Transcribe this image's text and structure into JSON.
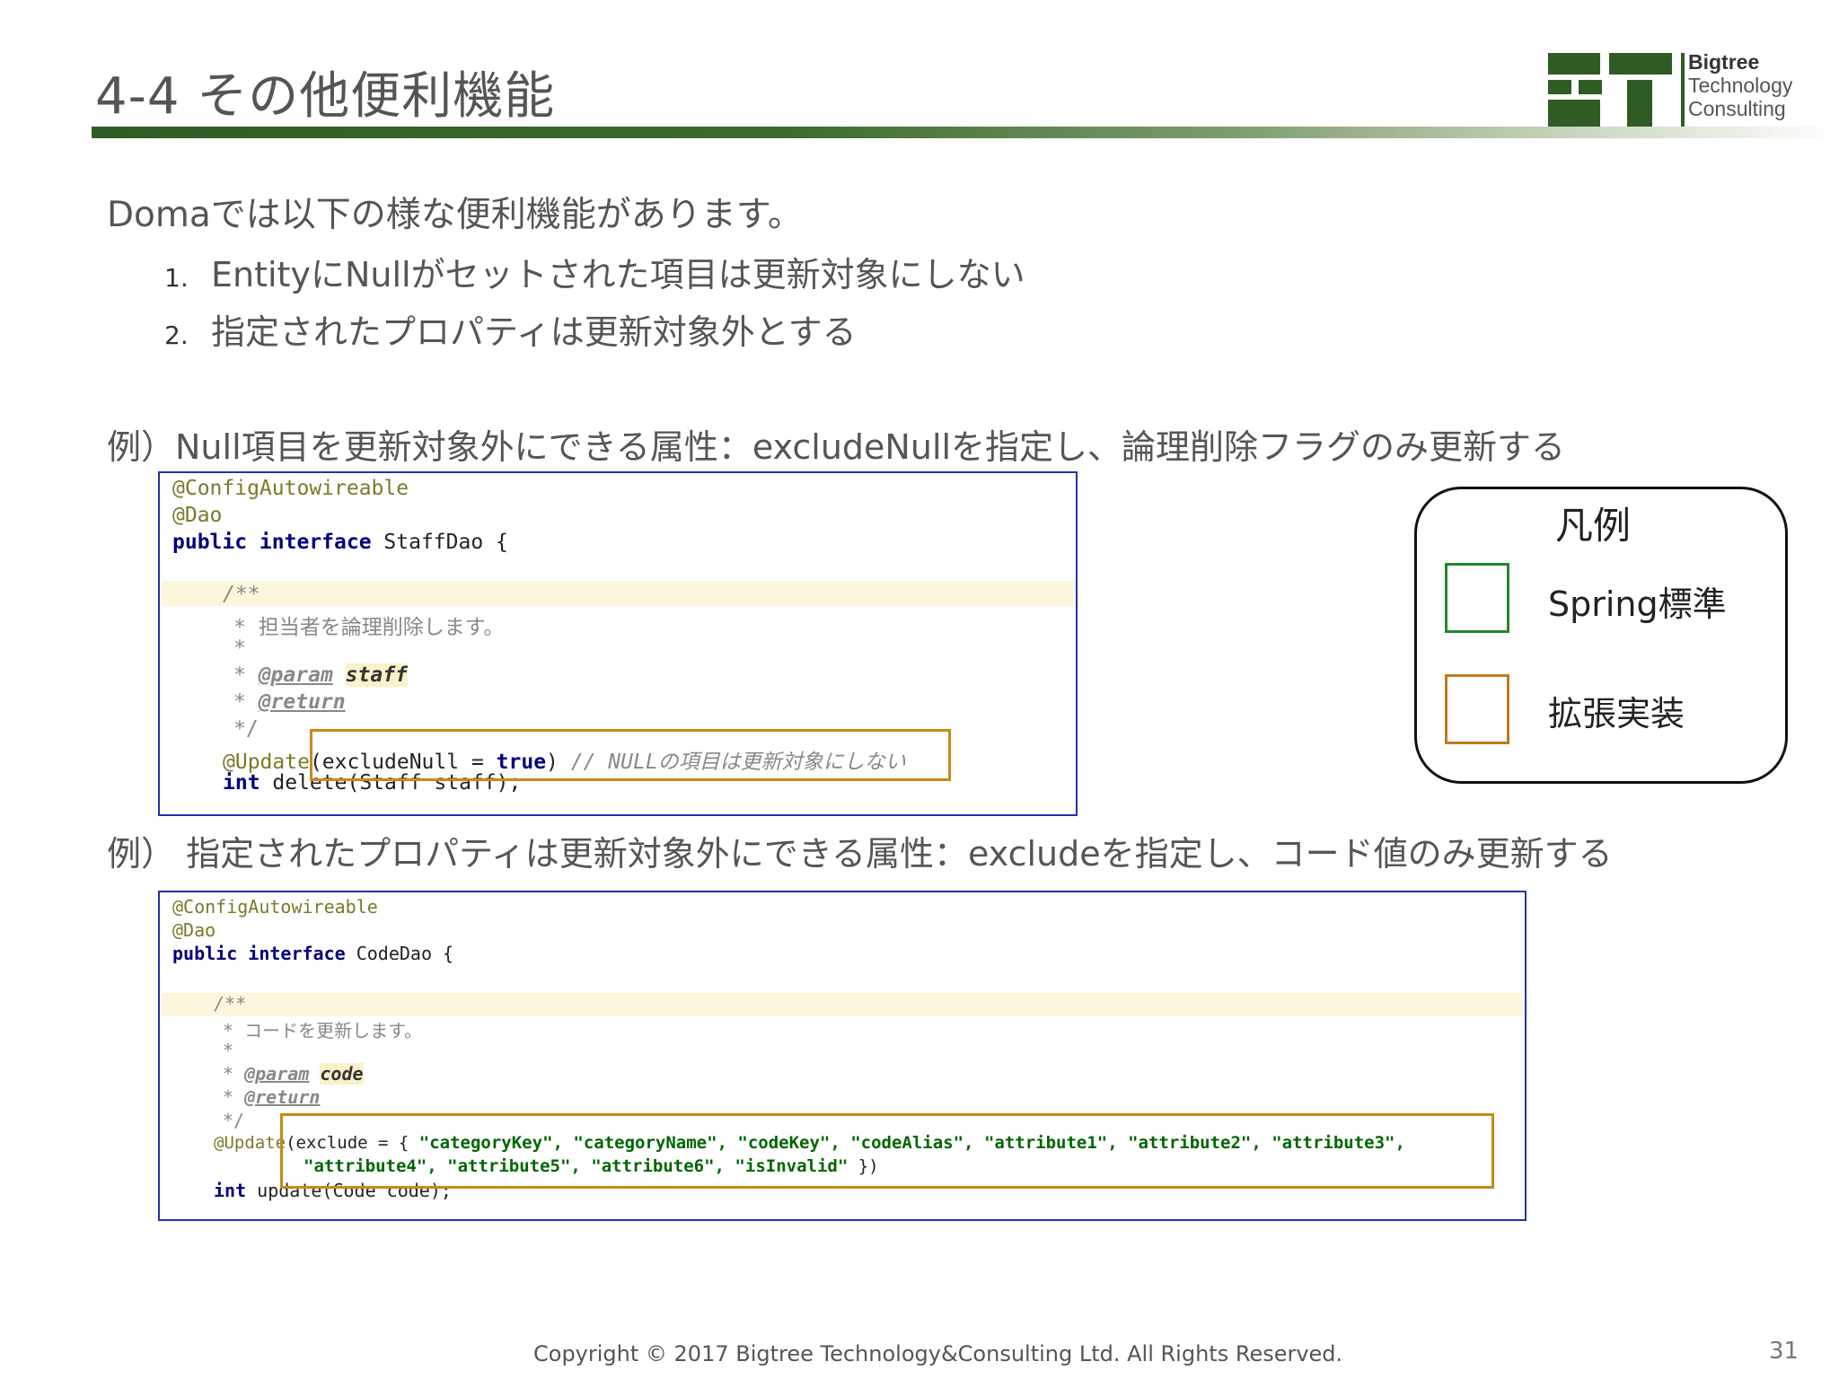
{
  "title": "4-4 その他便利機能",
  "logo": {
    "line1": "Bigtree",
    "line2": "Technology",
    "line3": "Consulting",
    "accent_color": "#2f5c24"
  },
  "intro": "Domaでは以下の様な便利機能があります。",
  "list": [
    {
      "num": "1.",
      "text": "EntityにNullがセットされた項目は更新対象にしない"
    },
    {
      "num": "2.",
      "text": "指定されたプロパティは更新対象外とする"
    }
  ],
  "example1": {
    "caption": "例）Null項目を更新対象外にできる属性：excludeNullを指定し、論理削除フラグのみ更新する",
    "code": {
      "l1": "@ConfigAutowireable",
      "l2": "@Dao",
      "l3_kw": "public interface",
      "l3_rest": " StaffDao {",
      "l5": "/**",
      "l6": "* 担当者を論理削除します。",
      "l7": "*",
      "l8_star": "* ",
      "l8_tag": "@param",
      "l8_name": "staff",
      "l9_star": "* ",
      "l9_tag": "@return",
      "l10": "*/",
      "l11_ann": "@Update",
      "l11_open": "(excludeNull = ",
      "l11_true": "true",
      "l11_close": ")",
      "l11_comment": " // NULLの項目は更新対象にしない",
      "l12_kw": "int",
      "l12_rest": " delete(Staff staff);"
    }
  },
  "example2": {
    "caption": "例） 指定されたプロパティは更新対象外にできる属性：excludeを指定し、コード値のみ更新する",
    "code": {
      "l1": "@ConfigAutowireable",
      "l2": "@Dao",
      "l3_kw": "public interface",
      "l3_rest": " CodeDao {",
      "l5": "/**",
      "l6": "* コードを更新します。",
      "l7": "*",
      "l8_star": "* ",
      "l8_tag": "@param",
      "l8_name": "code",
      "l9_star": "* ",
      "l9_tag": "@return",
      "l10": "*/",
      "l11_ann": "@Update",
      "l11_open": "(exclude = { ",
      "l11_strings": "\"categoryKey\", \"categoryName\", \"codeKey\", \"codeAlias\", \"attribute1\", \"attribute2\", \"attribute3\",",
      "l12_strings": "\"attribute4\", \"attribute5\", \"attribute6\", \"isInvalid\"",
      "l12_close": " })",
      "l13_kw": "int",
      "l13_rest": " update(Code code);"
    }
  },
  "legend": {
    "title": "凡例",
    "items": [
      {
        "label": "Spring標準",
        "color": "#1f8a2a"
      },
      {
        "label": "拡張実装",
        "color": "#c07a1c"
      }
    ]
  },
  "footer": "Copyright © 2017 Bigtree Technology&Consulting Ltd. All Rights Reserved.",
  "page_number": "31"
}
